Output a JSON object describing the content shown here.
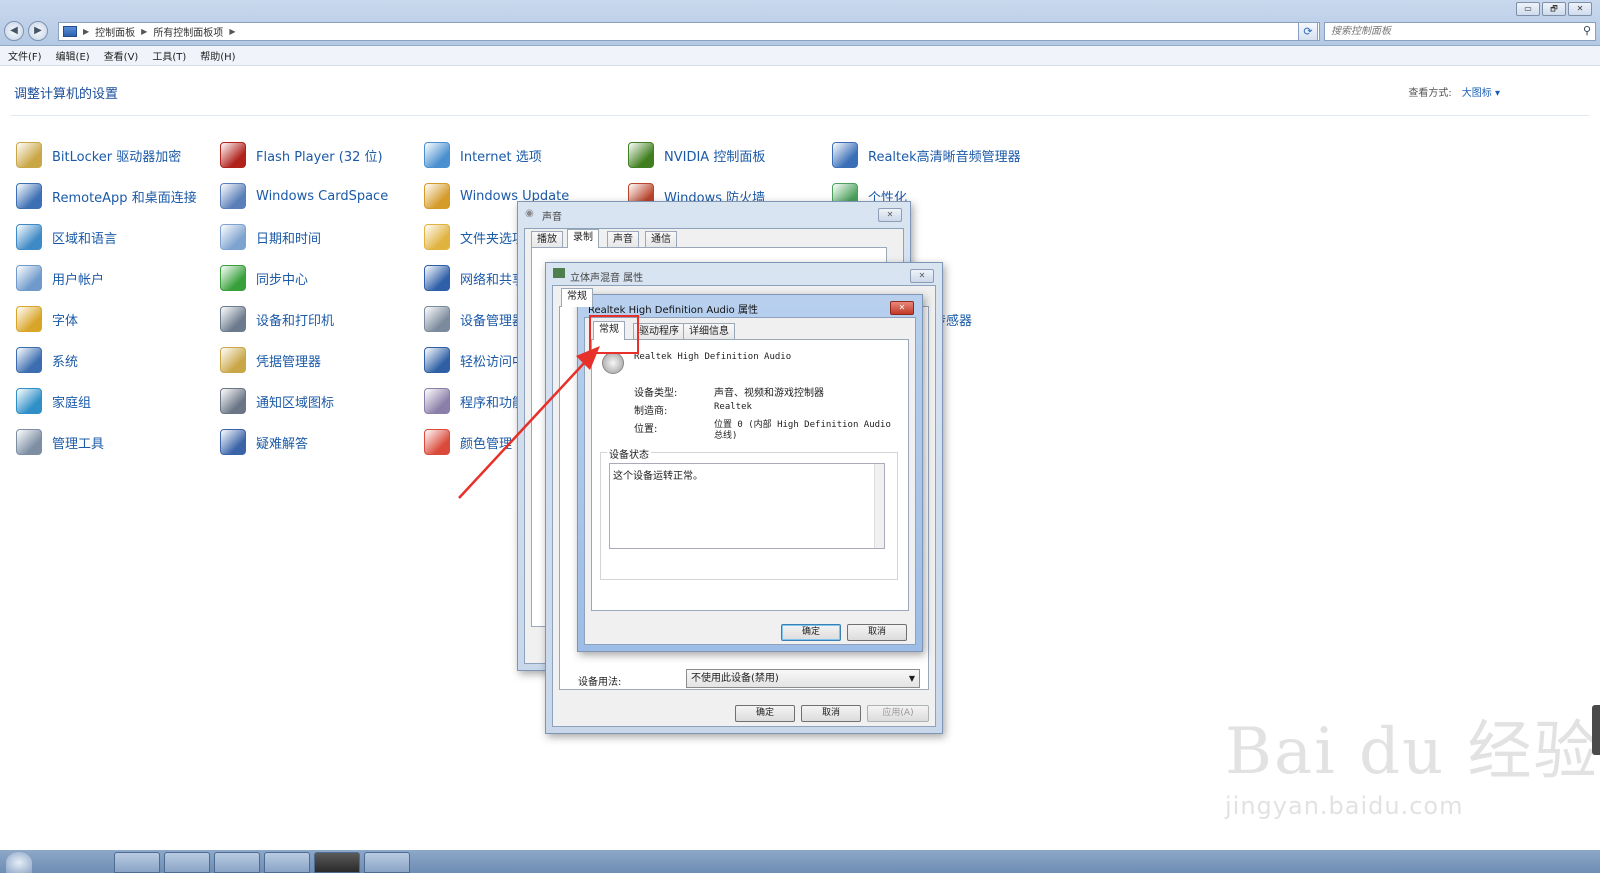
{
  "window": {
    "buttons": [
      "▭",
      "🗗",
      "✕"
    ]
  },
  "addressbar": {
    "crumbs": [
      "控制面板",
      "所有控制面板项"
    ],
    "search_placeholder": "搜索控制面板"
  },
  "menubar": [
    "文件(F)",
    "编辑(E)",
    "查看(V)",
    "工具(T)",
    "帮助(H)"
  ],
  "page": {
    "heading": "调整计算机的设置",
    "view_label": "查看方式:",
    "view_value": "大图标 ▾"
  },
  "items": [
    {
      "label": "BitLocker 驱动器加密",
      "icon": "bitlocker-key-icon",
      "color": "#c9a646"
    },
    {
      "label": "Flash Player (32 位)",
      "icon": "flash-icon",
      "color": "#b0221c"
    },
    {
      "label": "Internet 选项",
      "icon": "internet-globe-icon",
      "color": "#4a90d0"
    },
    {
      "label": "NVIDIA 控制面板",
      "icon": "nvidia-icon",
      "color": "#3f7f1f"
    },
    {
      "label": "Realtek高清晰音频管理器",
      "icon": "realtek-icon",
      "color": "#3a6fb8"
    },
    {
      "label": "RemoteApp 和桌面连接",
      "icon": "remoteapp-icon",
      "color": "#3c6fb3"
    },
    {
      "label": "Windows CardSpace",
      "icon": "cardspace-icon",
      "color": "#5a7fb8"
    },
    {
      "label": "Windows Update",
      "icon": "windows-update-icon",
      "color": "#d49a2a"
    },
    {
      "label": "Windows 防火墙",
      "icon": "firewall-icon",
      "color": "#b8442c"
    },
    {
      "label": "个性化",
      "icon": "personalize-icon",
      "color": "#4aa05a"
    },
    {
      "label": "区域和语言",
      "icon": "region-globe-icon",
      "color": "#3e8ac6"
    },
    {
      "label": "日期和时间",
      "icon": "calendar-clock-icon",
      "color": "#7ea3cf"
    },
    {
      "label": "文件夹选项",
      "icon": "folder-icon",
      "color": "#e0b23e"
    },
    {
      "label": "用户帐户",
      "icon": "users-icon",
      "color": "#6f9acb"
    },
    {
      "label": "同步中心",
      "icon": "sync-icon",
      "color": "#37a03a"
    },
    {
      "label": "网络和共享中心",
      "icon": "network-icon",
      "color": "#2f5fa8"
    },
    {
      "label": "字体",
      "icon": "font-icon",
      "color": "#d9a528"
    },
    {
      "label": "设备和打印机",
      "icon": "printer-icon",
      "color": "#6b7a8c"
    },
    {
      "label": "设备管理器",
      "icon": "device-manager-icon",
      "color": "#7b8a9c"
    },
    {
      "label": "系统",
      "icon": "system-icon",
      "color": "#3b6db0"
    },
    {
      "label": "凭据管理器",
      "icon": "credential-icon",
      "color": "#c9a646"
    },
    {
      "label": "轻松访问中心",
      "icon": "ease-access-icon",
      "color": "#2f60a6"
    },
    {
      "label": "家庭组",
      "icon": "homegroup-icon",
      "color": "#2f8fc6"
    },
    {
      "label": "通知区域图标",
      "icon": "tray-icon",
      "color": "#6a7585"
    },
    {
      "label": "程序和功能",
      "icon": "programs-icon",
      "color": "#8a7fa8"
    },
    {
      "label": "管理工具",
      "icon": "admin-tools-icon",
      "color": "#7d8ea3"
    },
    {
      "label": "疑难解答",
      "icon": "troubleshoot-icon",
      "color": "#3b64a8"
    },
    {
      "label": "颜色管理",
      "icon": "color-mgmt-icon",
      "color": "#d94a3a"
    },
    {
      "label": "位置和其他传感器",
      "icon": "sensor-icon",
      "color": "#3a7ab8"
    }
  ],
  "sound_dialog": {
    "title": "声音",
    "tabs": [
      "播放",
      "录制",
      "声音",
      "通信"
    ],
    "close": "✕"
  },
  "stereo_dialog": {
    "title": "立体声混音 属性",
    "tab": "常规",
    "device_usage_label": "设备用法:",
    "device_usage_value": "不使用此设备(禁用)",
    "ok": "确定",
    "cancel": "取消",
    "apply": "应用(A)",
    "close": "✕"
  },
  "realtek_dialog": {
    "title": "Realtek High Definition Audio 属性",
    "tabs": [
      "常规",
      "驱动程序",
      "详细信息"
    ],
    "device_name": "Realtek High Definition Audio",
    "device_type_label": "设备类型:",
    "device_type_value": "声音、视频和游戏控制器",
    "manufacturer_label": "制造商:",
    "manufacturer_value": "Realtek",
    "location_label": "位置:",
    "location_value": "位置 0 (内部 High Definition Audio 总线)",
    "status_label": "设备状态",
    "status_value": "这个设备运转正常。",
    "ok": "确定",
    "cancel": "取消",
    "close": "✕"
  },
  "watermark": {
    "big": "Bai du 经验",
    "small": "jingyan.baidu.com"
  },
  "colors": {
    "link": "#1b5aa8",
    "highlight": "#e8302a"
  }
}
